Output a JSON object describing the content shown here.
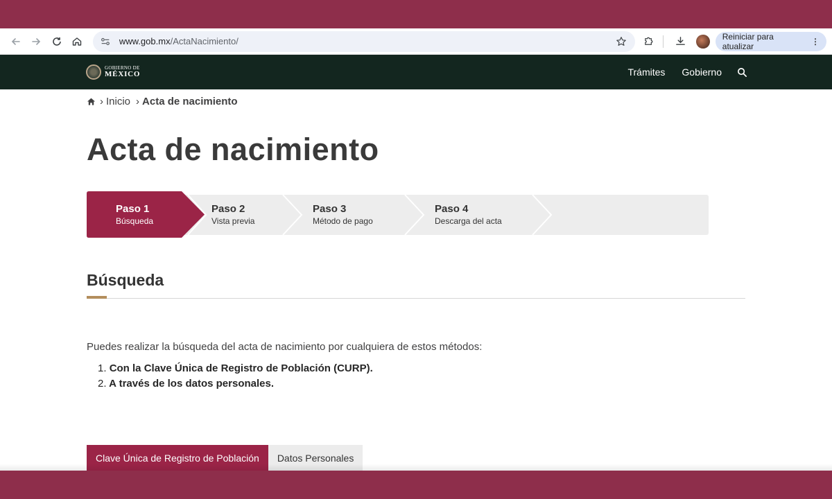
{
  "browser": {
    "url_host": "www.gob.mx",
    "url_path": "/ActaNacimiento/",
    "update_label": "Reiniciar para atualizar"
  },
  "header": {
    "logo_line1": "GOBIERNO DE",
    "logo_line2": "MÉXICO",
    "nav": [
      "Trámites",
      "Gobierno"
    ]
  },
  "breadcrumb": {
    "sep": "›",
    "inicio": "Inicio",
    "current": "Acta de nacimiento"
  },
  "page": {
    "title": "Acta de nacimiento"
  },
  "stepper": {
    "active_color": "#9b2447",
    "inactive_color": "#ededed",
    "steps": [
      {
        "num": "Paso 1",
        "desc": "Búsqueda"
      },
      {
        "num": "Paso 2",
        "desc": "Vista previa"
      },
      {
        "num": "Paso 3",
        "desc": "Método de pago"
      },
      {
        "num": "Paso 4",
        "desc": "Descarga del acta"
      }
    ]
  },
  "section": {
    "title": "Búsqueda",
    "intro": "Puedes realizar la búsqueda del acta de nacimiento por cualquiera de estos métodos:",
    "methods": [
      {
        "n": "1.",
        "text": "Con la Clave Única de Registro de Población (CURP)."
      },
      {
        "n": "2.",
        "text": "A través de los datos personales."
      }
    ]
  },
  "tabs": [
    {
      "label": "Clave Única de Registro de Población"
    },
    {
      "label": "Datos Personales"
    }
  ]
}
